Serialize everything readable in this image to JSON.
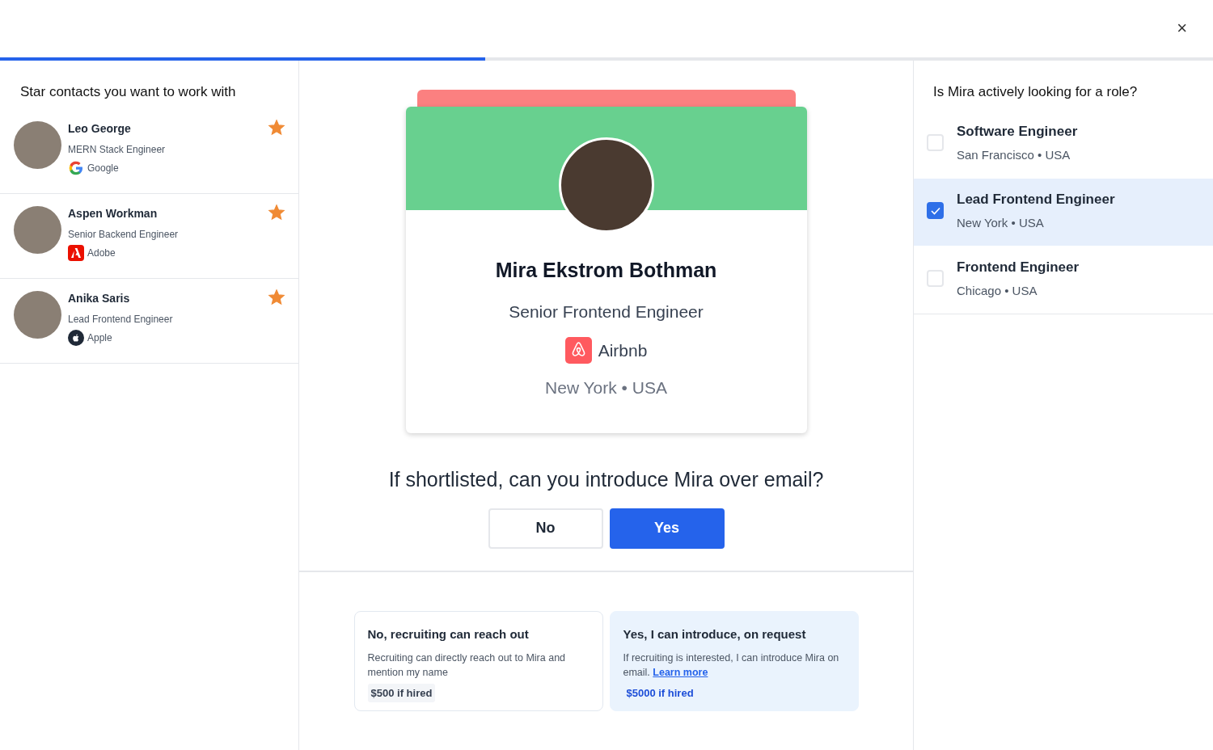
{
  "close_label": "×",
  "progress": {
    "level": 0.4
  },
  "contacts": {
    "title": "Star contacts you want to work with",
    "items": [
      {
        "name": "Leo George",
        "role": "MERN Stack Engineer",
        "company": "Google",
        "kind": "google",
        "starred": true
      },
      {
        "name": "Aspen Workman",
        "role": "Senior Backend Engineer",
        "company": "Adobe",
        "kind": "adobe",
        "starred": true
      },
      {
        "name": "Anika Saris",
        "role": "Lead Frontend Engineer",
        "company": "Apple",
        "kind": "apple",
        "starred": true
      }
    ]
  },
  "profile": {
    "name": "Mira Ekstrom Bothman",
    "role": "Senior Frontend Engineer",
    "company": "Airbnb",
    "location": "New York • USA"
  },
  "question": "If shortlisted, can you introduce Mira over email?",
  "answers": [
    {
      "label": "No",
      "selected": false
    },
    {
      "label": "Yes",
      "selected": true
    }
  ],
  "options": [
    {
      "title": "No, recruiting can reach out",
      "text": "Recruiting can directly reach out to Mira and mention my name",
      "reward": "$500 if hired",
      "selected": false
    },
    {
      "title": "Yes, I can introduce, on request",
      "text": "If recruiting is interested, I can introduce Mira on email.",
      "link": "Learn more",
      "reward": "$5000 if hired",
      "selected": true
    }
  ],
  "roles": {
    "title": "Is Mira actively looking for a role?",
    "items": [
      {
        "title": "Software Engineer",
        "location": "San Francisco • USA",
        "checked": false
      },
      {
        "title": "Lead Frontend Engineer",
        "location": "New York • USA",
        "checked": true
      },
      {
        "title": "Frontend Engineer",
        "location": "Chicago • USA",
        "checked": false
      }
    ]
  }
}
